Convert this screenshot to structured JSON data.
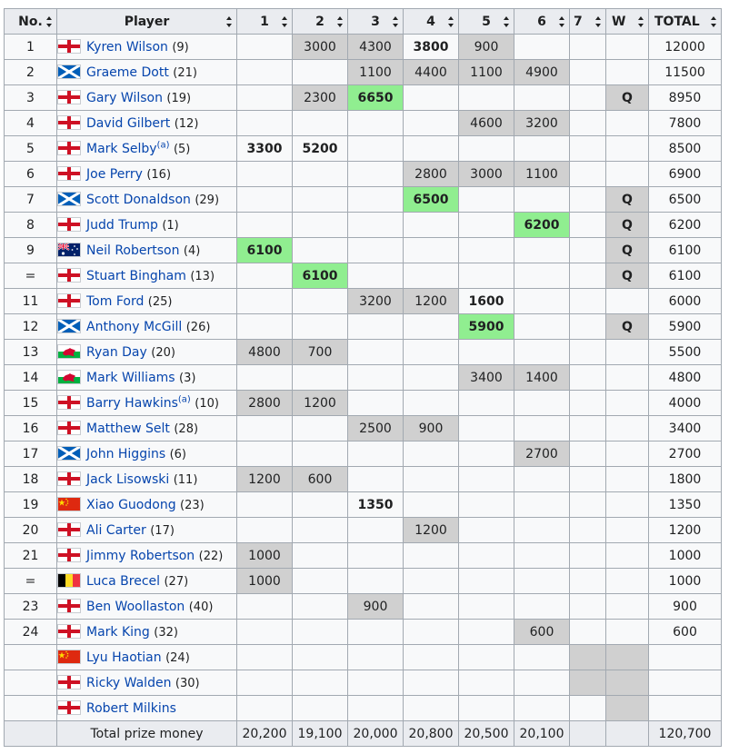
{
  "headers": [
    "No.",
    "Player",
    "1",
    "2",
    "3",
    "4",
    "5",
    "6",
    "7",
    "W",
    "TOTAL"
  ],
  "flags": {
    "ENG": {
      "icon": "england-flag-icon",
      "colors": [
        "#ffffff",
        "#ce1124"
      ]
    },
    "SCO": {
      "icon": "scotland-flag-icon",
      "colors": [
        "#005eb8",
        "#ffffff"
      ]
    },
    "AUS": {
      "icon": "australia-flag-icon",
      "colors": [
        "#012169",
        "#e4002b",
        "#ffffff"
      ]
    },
    "WAL": {
      "icon": "wales-flag-icon",
      "colors": [
        "#ffffff",
        "#00b140",
        "#d30731"
      ]
    },
    "CHN": {
      "icon": "china-flag-icon",
      "colors": [
        "#de2910",
        "#ffde00"
      ]
    },
    "BEL": {
      "icon": "belgium-flag-icon",
      "colors": [
        "#000000",
        "#fdda24",
        "#ef3340"
      ]
    }
  },
  "rows": [
    {
      "no": "1",
      "flag": "ENG",
      "name": "Kyren Wilson",
      "note": "",
      "seed": "(9)",
      "cells": [
        [
          "e",
          ""
        ],
        [
          "x",
          "3000"
        ],
        [
          "x",
          "4300"
        ],
        [
          "b",
          "3800"
        ],
        [
          "x",
          "900"
        ],
        [
          "e",
          ""
        ],
        [
          "e",
          ""
        ],
        [
          "e",
          ""
        ]
      ],
      "total": "12000"
    },
    {
      "no": "2",
      "flag": "SCO",
      "name": "Graeme Dott",
      "note": "",
      "seed": "(21)",
      "cells": [
        [
          "e",
          ""
        ],
        [
          "e",
          ""
        ],
        [
          "x",
          "1100"
        ],
        [
          "x",
          "4400"
        ],
        [
          "x",
          "1100"
        ],
        [
          "x",
          "4900"
        ],
        [
          "e",
          ""
        ],
        [
          "e",
          ""
        ]
      ],
      "total": "11500"
    },
    {
      "no": "3",
      "flag": "ENG",
      "name": "Gary Wilson",
      "note": "",
      "seed": "(19)",
      "cells": [
        [
          "e",
          ""
        ],
        [
          "x",
          "2300"
        ],
        [
          "w",
          "6650"
        ],
        [
          "e",
          ""
        ],
        [
          "e",
          ""
        ],
        [
          "e",
          ""
        ],
        [
          "e",
          ""
        ],
        [
          "x",
          "Q"
        ]
      ],
      "total": "8950"
    },
    {
      "no": "4",
      "flag": "ENG",
      "name": "David Gilbert",
      "note": "",
      "seed": "(12)",
      "cells": [
        [
          "e",
          ""
        ],
        [
          "e",
          ""
        ],
        [
          "e",
          ""
        ],
        [
          "e",
          ""
        ],
        [
          "x",
          "4600"
        ],
        [
          "x",
          "3200"
        ],
        [
          "e",
          ""
        ],
        [
          "e",
          ""
        ]
      ],
      "total": "7800"
    },
    {
      "no": "5",
      "flag": "ENG",
      "name": "Mark Selby",
      "note": "(a)",
      "seed": "(5)",
      "cells": [
        [
          "b",
          "3300"
        ],
        [
          "b",
          "5200"
        ],
        [
          "e",
          ""
        ],
        [
          "e",
          ""
        ],
        [
          "e",
          ""
        ],
        [
          "e",
          ""
        ],
        [
          "e",
          ""
        ],
        [
          "e",
          ""
        ]
      ],
      "total": "8500"
    },
    {
      "no": "6",
      "flag": "ENG",
      "name": "Joe Perry",
      "note": "",
      "seed": "(16)",
      "cells": [
        [
          "e",
          ""
        ],
        [
          "e",
          ""
        ],
        [
          "e",
          ""
        ],
        [
          "x",
          "2800"
        ],
        [
          "x",
          "3000"
        ],
        [
          "x",
          "1100"
        ],
        [
          "e",
          ""
        ],
        [
          "e",
          ""
        ]
      ],
      "total": "6900"
    },
    {
      "no": "7",
      "flag": "SCO",
      "name": "Scott Donaldson",
      "note": "",
      "seed": "(29)",
      "cells": [
        [
          "e",
          ""
        ],
        [
          "e",
          ""
        ],
        [
          "e",
          ""
        ],
        [
          "w",
          "6500"
        ],
        [
          "e",
          ""
        ],
        [
          "e",
          ""
        ],
        [
          "e",
          ""
        ],
        [
          "x",
          "Q"
        ]
      ],
      "total": "6500"
    },
    {
      "no": "8",
      "flag": "ENG",
      "name": "Judd Trump",
      "note": "",
      "seed": "(1)",
      "cells": [
        [
          "e",
          ""
        ],
        [
          "e",
          ""
        ],
        [
          "e",
          ""
        ],
        [
          "e",
          ""
        ],
        [
          "e",
          ""
        ],
        [
          "w",
          "6200"
        ],
        [
          "e",
          ""
        ],
        [
          "x",
          "Q"
        ]
      ],
      "total": "6200"
    },
    {
      "no": "9",
      "flag": "AUS",
      "name": "Neil Robertson",
      "note": "",
      "seed": "(4)",
      "cells": [
        [
          "w",
          "6100"
        ],
        [
          "e",
          ""
        ],
        [
          "e",
          ""
        ],
        [
          "e",
          ""
        ],
        [
          "e",
          ""
        ],
        [
          "e",
          ""
        ],
        [
          "e",
          ""
        ],
        [
          "x",
          "Q"
        ]
      ],
      "total": "6100"
    },
    {
      "no": "=",
      "flag": "ENG",
      "name": "Stuart Bingham",
      "note": "",
      "seed": "(13)",
      "cells": [
        [
          "e",
          ""
        ],
        [
          "w",
          "6100"
        ],
        [
          "e",
          ""
        ],
        [
          "e",
          ""
        ],
        [
          "e",
          ""
        ],
        [
          "e",
          ""
        ],
        [
          "e",
          ""
        ],
        [
          "x",
          "Q"
        ]
      ],
      "total": "6100"
    },
    {
      "no": "11",
      "flag": "ENG",
      "name": "Tom Ford",
      "note": "",
      "seed": "(25)",
      "cells": [
        [
          "e",
          ""
        ],
        [
          "e",
          ""
        ],
        [
          "x",
          "3200"
        ],
        [
          "x",
          "1200"
        ],
        [
          "b",
          "1600"
        ],
        [
          "e",
          ""
        ],
        [
          "e",
          ""
        ],
        [
          "e",
          ""
        ]
      ],
      "total": "6000"
    },
    {
      "no": "12",
      "flag": "SCO",
      "name": "Anthony McGill",
      "note": "",
      "seed": "(26)",
      "cells": [
        [
          "e",
          ""
        ],
        [
          "e",
          ""
        ],
        [
          "e",
          ""
        ],
        [
          "e",
          ""
        ],
        [
          "w",
          "5900"
        ],
        [
          "e",
          ""
        ],
        [
          "e",
          ""
        ],
        [
          "x",
          "Q"
        ]
      ],
      "total": "5900"
    },
    {
      "no": "13",
      "flag": "WAL",
      "name": "Ryan Day",
      "note": "",
      "seed": "(20)",
      "cells": [
        [
          "x",
          "4800"
        ],
        [
          "x",
          "700"
        ],
        [
          "e",
          ""
        ],
        [
          "e",
          ""
        ],
        [
          "e",
          ""
        ],
        [
          "e",
          ""
        ],
        [
          "e",
          ""
        ],
        [
          "e",
          ""
        ]
      ],
      "total": "5500"
    },
    {
      "no": "14",
      "flag": "WAL",
      "name": "Mark Williams",
      "note": "",
      "seed": "(3)",
      "cells": [
        [
          "e",
          ""
        ],
        [
          "e",
          ""
        ],
        [
          "e",
          ""
        ],
        [
          "e",
          ""
        ],
        [
          "x",
          "3400"
        ],
        [
          "x",
          "1400"
        ],
        [
          "e",
          ""
        ],
        [
          "e",
          ""
        ]
      ],
      "total": "4800"
    },
    {
      "no": "15",
      "flag": "ENG",
      "name": "Barry Hawkins",
      "note": "(a)",
      "seed": "(10)",
      "cells": [
        [
          "x",
          "2800"
        ],
        [
          "x",
          "1200"
        ],
        [
          "e",
          ""
        ],
        [
          "e",
          ""
        ],
        [
          "e",
          ""
        ],
        [
          "e",
          ""
        ],
        [
          "e",
          ""
        ],
        [
          "e",
          ""
        ]
      ],
      "total": "4000"
    },
    {
      "no": "16",
      "flag": "ENG",
      "name": "Matthew Selt",
      "note": "",
      "seed": "(28)",
      "cells": [
        [
          "e",
          ""
        ],
        [
          "e",
          ""
        ],
        [
          "x",
          "2500"
        ],
        [
          "x",
          "900"
        ],
        [
          "e",
          ""
        ],
        [
          "e",
          ""
        ],
        [
          "e",
          ""
        ],
        [
          "e",
          ""
        ]
      ],
      "total": "3400"
    },
    {
      "no": "17",
      "flag": "SCO",
      "name": "John Higgins",
      "note": "",
      "seed": "(6)",
      "cells": [
        [
          "e",
          ""
        ],
        [
          "e",
          ""
        ],
        [
          "e",
          ""
        ],
        [
          "e",
          ""
        ],
        [
          "e",
          ""
        ],
        [
          "x",
          "2700"
        ],
        [
          "e",
          ""
        ],
        [
          "e",
          ""
        ]
      ],
      "total": "2700"
    },
    {
      "no": "18",
      "flag": "ENG",
      "name": "Jack Lisowski",
      "note": "",
      "seed": "(11)",
      "cells": [
        [
          "x",
          "1200"
        ],
        [
          "x",
          "600"
        ],
        [
          "e",
          ""
        ],
        [
          "e",
          ""
        ],
        [
          "e",
          ""
        ],
        [
          "e",
          ""
        ],
        [
          "e",
          ""
        ],
        [
          "e",
          ""
        ]
      ],
      "total": "1800"
    },
    {
      "no": "19",
      "flag": "CHN",
      "name": "Xiao Guodong",
      "note": "",
      "seed": "(23)",
      "cells": [
        [
          "e",
          ""
        ],
        [
          "e",
          ""
        ],
        [
          "b",
          "1350"
        ],
        [
          "e",
          ""
        ],
        [
          "e",
          ""
        ],
        [
          "e",
          ""
        ],
        [
          "e",
          ""
        ],
        [
          "e",
          ""
        ]
      ],
      "total": "1350"
    },
    {
      "no": "20",
      "flag": "ENG",
      "name": "Ali Carter",
      "note": "",
      "seed": "(17)",
      "cells": [
        [
          "e",
          ""
        ],
        [
          "e",
          ""
        ],
        [
          "e",
          ""
        ],
        [
          "x",
          "1200"
        ],
        [
          "e",
          ""
        ],
        [
          "e",
          ""
        ],
        [
          "e",
          ""
        ],
        [
          "e",
          ""
        ]
      ],
      "total": "1200"
    },
    {
      "no": "21",
      "flag": "ENG",
      "name": "Jimmy Robertson",
      "note": "",
      "seed": "(22)",
      "cells": [
        [
          "x",
          "1000"
        ],
        [
          "e",
          ""
        ],
        [
          "e",
          ""
        ],
        [
          "e",
          ""
        ],
        [
          "e",
          ""
        ],
        [
          "e",
          ""
        ],
        [
          "e",
          ""
        ],
        [
          "e",
          ""
        ]
      ],
      "total": "1000"
    },
    {
      "no": "=",
      "flag": "BEL",
      "name": "Luca Brecel",
      "note": "",
      "seed": "(27)",
      "cells": [
        [
          "x",
          "1000"
        ],
        [
          "e",
          ""
        ],
        [
          "e",
          ""
        ],
        [
          "e",
          ""
        ],
        [
          "e",
          ""
        ],
        [
          "e",
          ""
        ],
        [
          "e",
          ""
        ],
        [
          "e",
          ""
        ]
      ],
      "total": "1000"
    },
    {
      "no": "23",
      "flag": "ENG",
      "name": "Ben Woollaston",
      "note": "",
      "seed": "(40)",
      "cells": [
        [
          "e",
          ""
        ],
        [
          "e",
          ""
        ],
        [
          "x",
          "900"
        ],
        [
          "e",
          ""
        ],
        [
          "e",
          ""
        ],
        [
          "e",
          ""
        ],
        [
          "e",
          ""
        ],
        [
          "e",
          ""
        ]
      ],
      "total": "900"
    },
    {
      "no": "24",
      "flag": "ENG",
      "name": "Mark King",
      "note": "",
      "seed": "(32)",
      "cells": [
        [
          "e",
          ""
        ],
        [
          "e",
          ""
        ],
        [
          "e",
          ""
        ],
        [
          "e",
          ""
        ],
        [
          "e",
          ""
        ],
        [
          "x",
          "600"
        ],
        [
          "e",
          ""
        ],
        [
          "e",
          ""
        ]
      ],
      "total": "600"
    },
    {
      "no": "",
      "flag": "CHN",
      "name": "Lyu Haotian",
      "note": "",
      "seed": "(24)",
      "cells": [
        [
          "e",
          ""
        ],
        [
          "e",
          ""
        ],
        [
          "e",
          ""
        ],
        [
          "e",
          ""
        ],
        [
          "e",
          ""
        ],
        [
          "e",
          ""
        ],
        [
          "x",
          ""
        ],
        [
          "x",
          ""
        ]
      ],
      "total": ""
    },
    {
      "no": "",
      "flag": "ENG",
      "name": "Ricky Walden",
      "note": "",
      "seed": "(30)",
      "cells": [
        [
          "e",
          ""
        ],
        [
          "e",
          ""
        ],
        [
          "e",
          ""
        ],
        [
          "e",
          ""
        ],
        [
          "e",
          ""
        ],
        [
          "e",
          ""
        ],
        [
          "x",
          ""
        ],
        [
          "x",
          ""
        ]
      ],
      "total": ""
    },
    {
      "no": "",
      "flag": "ENG",
      "name": "Robert Milkins",
      "note": "",
      "seed": "",
      "cells": [
        [
          "e",
          ""
        ],
        [
          "e",
          ""
        ],
        [
          "e",
          ""
        ],
        [
          "e",
          ""
        ],
        [
          "e",
          ""
        ],
        [
          "e",
          ""
        ],
        [
          "e",
          ""
        ],
        [
          "x",
          ""
        ]
      ],
      "total": ""
    }
  ],
  "footer": {
    "label": "Total prize money",
    "values": [
      "20,200",
      "19,100",
      "20,000",
      "20,800",
      "20,500",
      "20,100",
      "",
      ""
    ],
    "total": "120,700"
  }
}
